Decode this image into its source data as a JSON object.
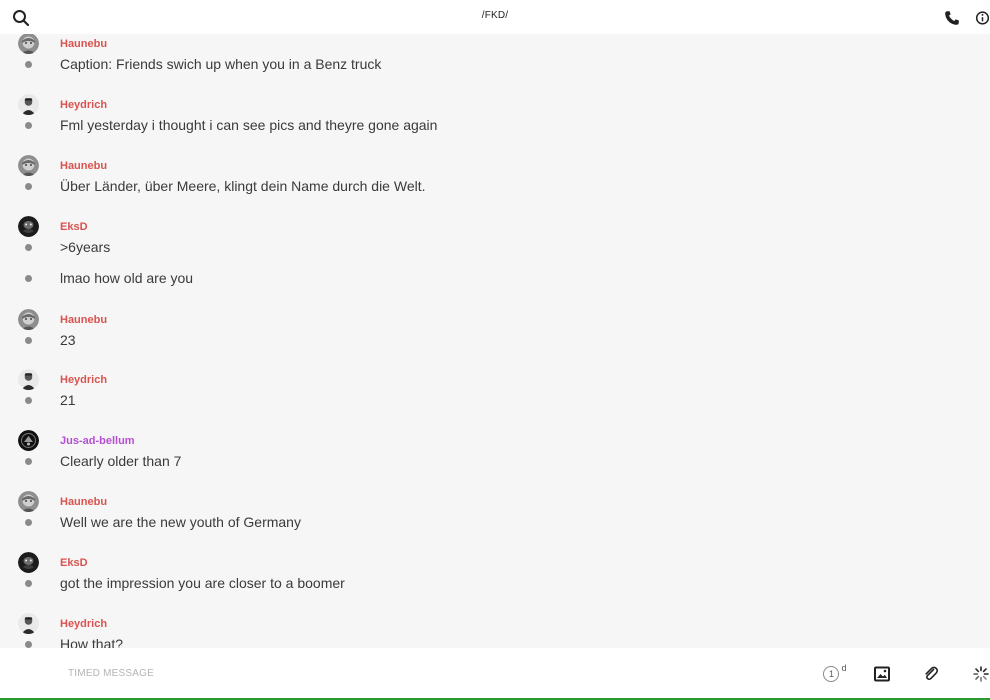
{
  "header": {
    "title": "/FKD/",
    "search_icon": "search-icon",
    "call_icon": "phone-icon",
    "info_icon": "info-icon"
  },
  "colors": {
    "sender_default": "#d9534f",
    "sender_alt": "#b44fd1",
    "dot": "#8a8a8a",
    "accent_edge": "#2e9a2e"
  },
  "messages": [
    {
      "sender": "Haunebu",
      "sender_color": "#d9534f",
      "avatar": "avatar-haunebu",
      "text": "Caption: Friends swich up when you in a Benz truck"
    },
    {
      "sender": "Heydrich",
      "sender_color": "#d9534f",
      "avatar": "avatar-heydrich",
      "text": "Fml yesterday i thought i can see pics and theyre gone again"
    },
    {
      "sender": "Haunebu",
      "sender_color": "#d9534f",
      "avatar": "avatar-haunebu",
      "text": "Über Länder, über Meere, klingt dein Name durch die Welt."
    },
    {
      "sender": "EksD",
      "sender_color": "#d9534f",
      "avatar": "avatar-eksd",
      "text": ">6years"
    },
    {
      "sender": "",
      "sender_color": "",
      "avatar": "",
      "text": "lmao how old are you"
    },
    {
      "sender": "Haunebu",
      "sender_color": "#d9534f",
      "avatar": "avatar-haunebu",
      "text": "23"
    },
    {
      "sender": "Heydrich",
      "sender_color": "#d9534f",
      "avatar": "avatar-heydrich",
      "text": "21"
    },
    {
      "sender": "Jus-ad-bellum",
      "sender_color": "#b44fd1",
      "avatar": "avatar-jus",
      "text": "Clearly older than 7"
    },
    {
      "sender": "Haunebu",
      "sender_color": "#d9534f",
      "avatar": "avatar-haunebu",
      "text": "Well we are the new youth of Germany"
    },
    {
      "sender": "EksD",
      "sender_color": "#d9534f",
      "avatar": "avatar-eksd",
      "text": "got the impression you are closer to a boomer"
    },
    {
      "sender": "Heydrich",
      "sender_color": "#d9534f",
      "avatar": "avatar-heydrich",
      "text": "How that?"
    }
  ],
  "composer": {
    "placeholder": "TIMED MESSAGE",
    "timer_value": "1",
    "timer_unit": "d",
    "image_icon": "image-icon",
    "attach_icon": "paperclip-icon",
    "loading_icon": "spinner-icon"
  }
}
